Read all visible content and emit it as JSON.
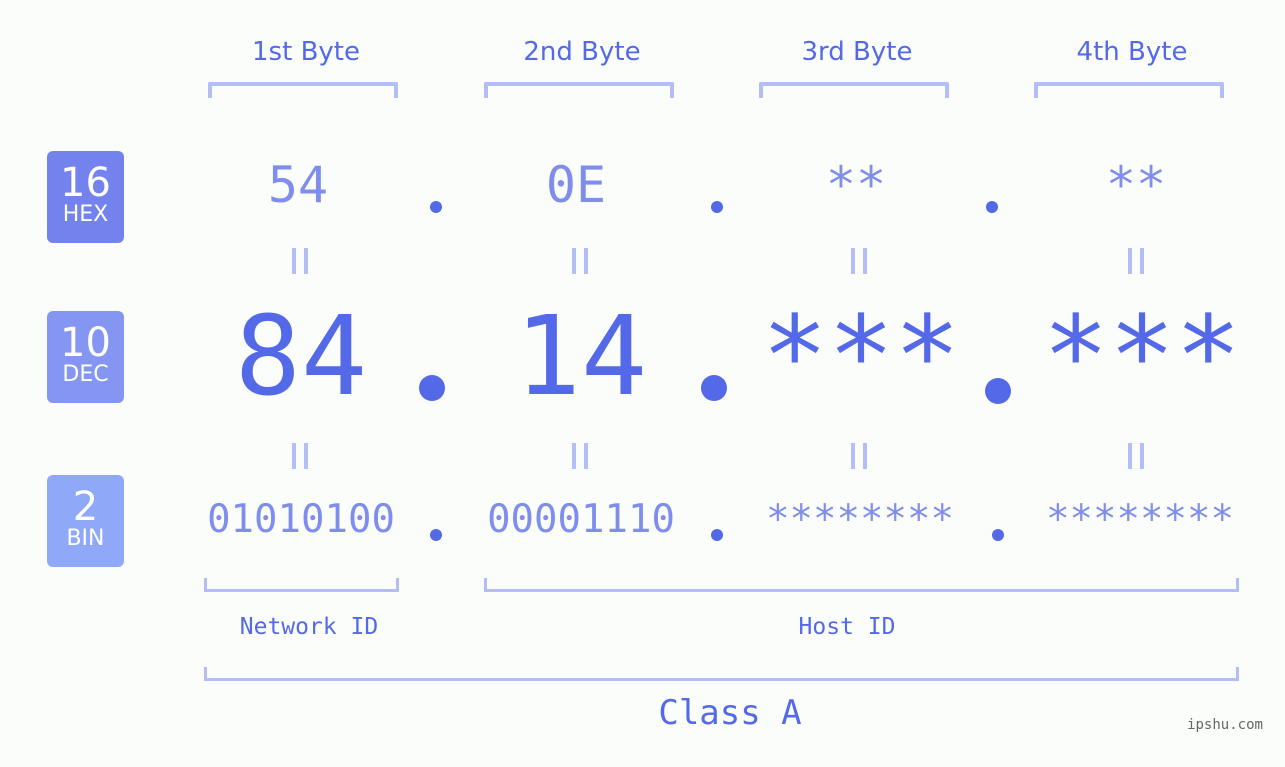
{
  "colors": {
    "accent": "#5469e8",
    "light_accent": "#7f8eed",
    "bracket": "#b3bdf8",
    "hex_badge": "#7382ec",
    "dec_badge": "#8495f2",
    "bin_badge": "#8fa8f8",
    "background": "#fbfdfb",
    "watermark": "#666666"
  },
  "bytes": {
    "headers": [
      "1st Byte",
      "2nd Byte",
      "3rd Byte",
      "4th Byte"
    ]
  },
  "badges": {
    "hex": {
      "number": "16",
      "label": "HEX"
    },
    "dec": {
      "number": "10",
      "label": "DEC"
    },
    "bin": {
      "number": "2",
      "label": "BIN"
    }
  },
  "hex_values": [
    "54",
    "0E",
    "**",
    "**"
  ],
  "dec_values": [
    "84",
    "14",
    "***",
    "***"
  ],
  "bin_values": [
    "01010100",
    "00001110",
    "********",
    "********"
  ],
  "labels": {
    "network_id": "Network ID",
    "host_id": "Host ID",
    "ip_class": "Class A"
  },
  "watermark": "ipshu.com"
}
